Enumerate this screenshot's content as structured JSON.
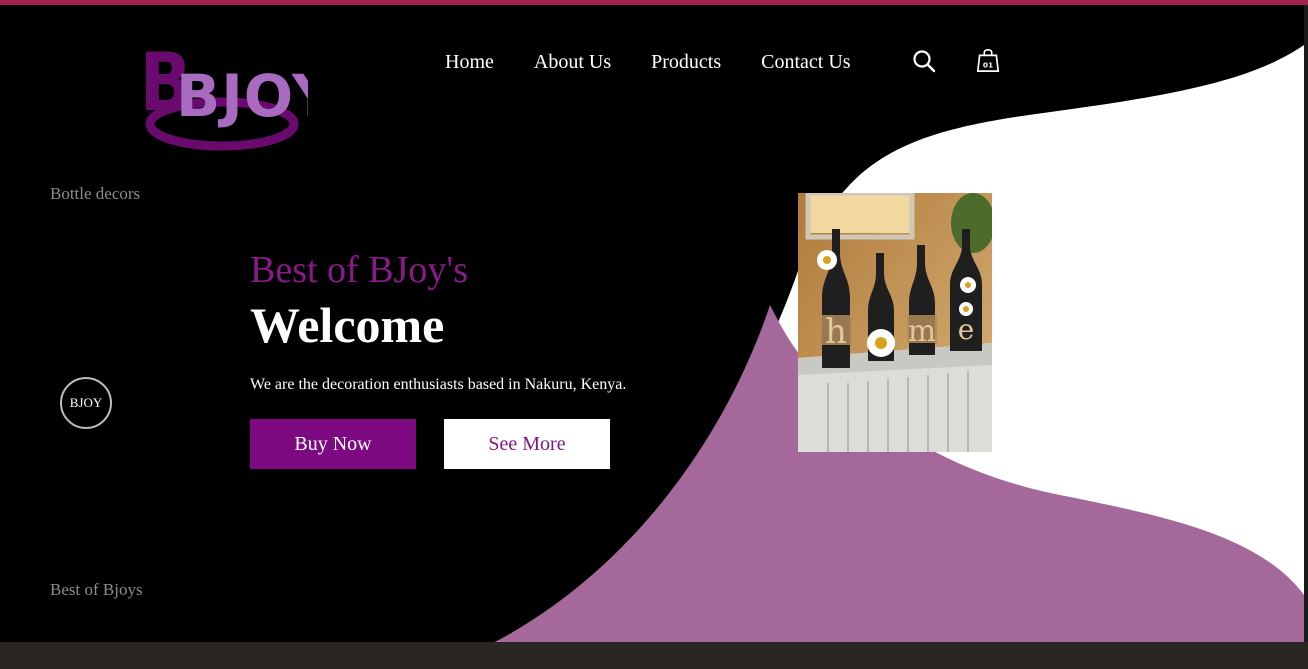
{
  "brand": {
    "logo_text": "BJOY"
  },
  "nav": {
    "items": [
      {
        "label": "Home"
      },
      {
        "label": "About Us"
      },
      {
        "label": "Products"
      },
      {
        "label": "Contact Us"
      }
    ],
    "cart_count": "01",
    "search_icon": "search-icon",
    "cart_icon": "shopping-bag-icon"
  },
  "sidebar": {
    "top_label": "Bottle decors",
    "badge": "BJOY",
    "bottom_label": "Best of Bjoys"
  },
  "hero": {
    "subtitle": "Best of BJoy's",
    "title": "Welcome",
    "description": "We are the decoration enthusiasts based in Nakuru, Kenya.",
    "primary_button": "Buy Now",
    "secondary_button": "See More",
    "image_letters": [
      "h",
      "o",
      "m",
      "e"
    ]
  },
  "colors": {
    "accent": "#7d0a80",
    "wave": "#a5689a",
    "background": "#000000",
    "top_bar": "#a3204f"
  }
}
